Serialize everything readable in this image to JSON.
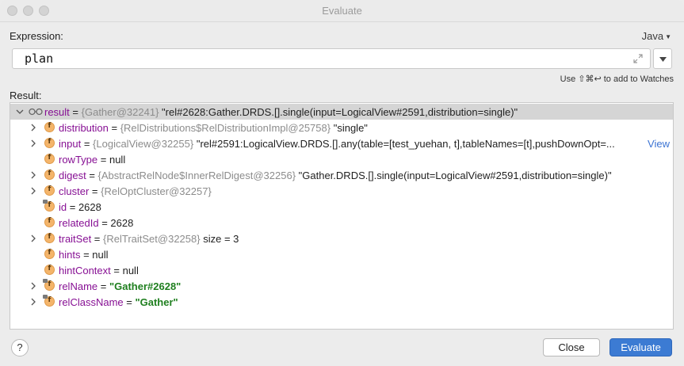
{
  "window": {
    "title": "Evaluate"
  },
  "expression": {
    "label": "Expression:",
    "language": "Java",
    "value": "plan",
    "hint": "Use ⇧⌘↩ to add to Watches"
  },
  "result": {
    "label": "Result:",
    "root": {
      "name": "result",
      "type": "{Gather@32241}",
      "value": "\"rel#2628:Gather.DRDS.[].single(input=LogicalView#2591,distribution=single)\""
    },
    "fields": [
      {
        "name": "distribution",
        "type": "{RelDistributions$RelDistributionImpl@25758}",
        "value": "\"single\"",
        "expandable": true,
        "locked": false,
        "string": false
      },
      {
        "name": "input",
        "type": "{LogicalView@32255}",
        "value": "\"rel#2591:LogicalView.DRDS.[].any(table=[test_yuehan, t],tableNames=[t],pushDownOpt=...",
        "expandable": true,
        "locked": false,
        "string": false,
        "link": "View"
      },
      {
        "name": "rowType",
        "type": "",
        "value": "null",
        "expandable": false,
        "locked": false,
        "string": false
      },
      {
        "name": "digest",
        "type": "{AbstractRelNode$InnerRelDigest@32256}",
        "value": "\"Gather.DRDS.[].single(input=LogicalView#2591,distribution=single)\"",
        "expandable": true,
        "locked": false,
        "string": false
      },
      {
        "name": "cluster",
        "type": "{RelOptCluster@32257}",
        "value": "",
        "expandable": true,
        "locked": false,
        "string": false
      },
      {
        "name": "id",
        "type": "",
        "value": "2628",
        "expandable": false,
        "locked": true,
        "string": false
      },
      {
        "name": "relatedId",
        "type": "",
        "value": "2628",
        "expandable": false,
        "locked": false,
        "string": false
      },
      {
        "name": "traitSet",
        "type": "{RelTraitSet@32258}",
        "value": " size = 3",
        "expandable": true,
        "locked": false,
        "string": false
      },
      {
        "name": "hints",
        "type": "",
        "value": "null",
        "expandable": false,
        "locked": false,
        "string": false
      },
      {
        "name": "hintContext",
        "type": "",
        "value": "null",
        "expandable": false,
        "locked": false,
        "string": false
      },
      {
        "name": "relName",
        "type": "",
        "value": "\"Gather#2628\"",
        "expandable": true,
        "locked": true,
        "string": true
      },
      {
        "name": "relClassName",
        "type": "",
        "value": "\"Gather\"",
        "expandable": true,
        "locked": true,
        "string": true
      }
    ]
  },
  "buttons": {
    "help": "?",
    "close": "Close",
    "evaluate": "Evaluate"
  }
}
